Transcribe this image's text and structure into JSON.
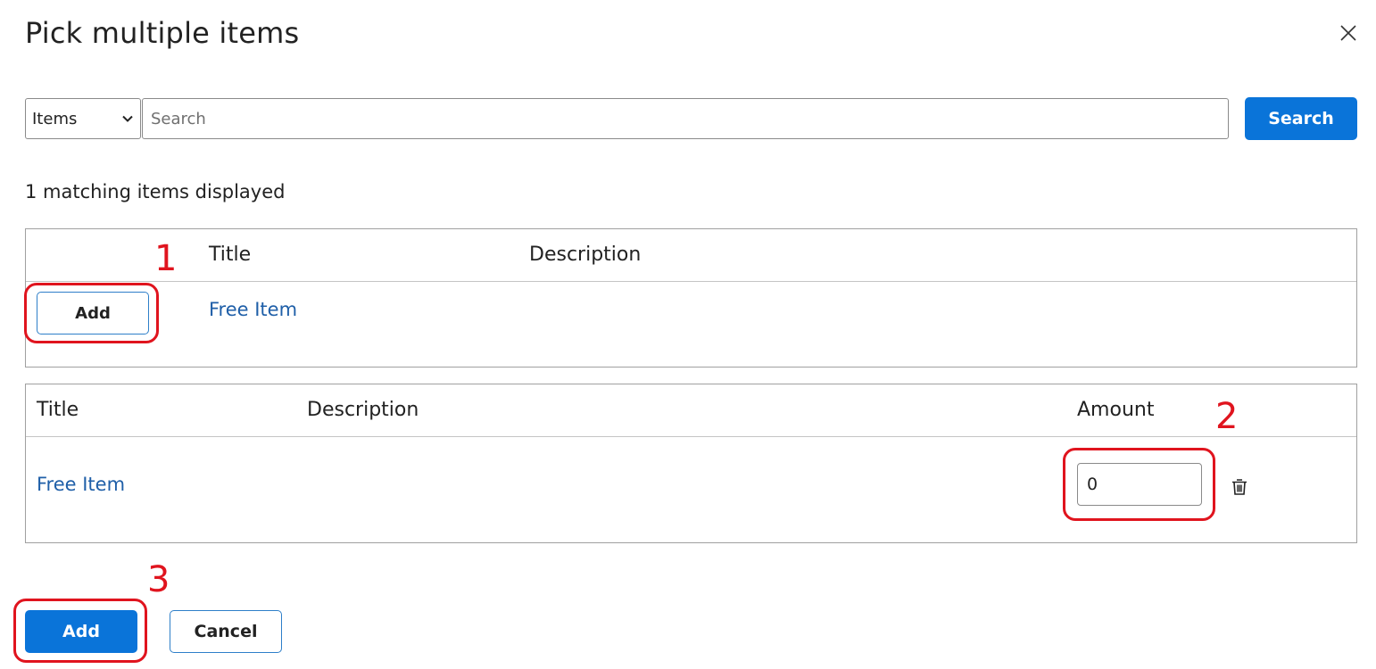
{
  "dialog": {
    "title": "Pick multiple items"
  },
  "search": {
    "type_selected": "Items",
    "placeholder": "Search",
    "value": "",
    "button_label": "Search"
  },
  "results": {
    "count_text": "1 matching items displayed",
    "columns": {
      "title": "Title",
      "description": "Description"
    },
    "rows": [
      {
        "add_label": "Add",
        "title": "Free Item",
        "description": ""
      }
    ]
  },
  "selected": {
    "columns": {
      "title": "Title",
      "description": "Description",
      "amount": "Amount"
    },
    "rows": [
      {
        "title": "Free Item",
        "description": "",
        "amount": "0"
      }
    ]
  },
  "footer": {
    "add_label": "Add",
    "cancel_label": "Cancel"
  },
  "annotations": [
    "1",
    "2",
    "3"
  ],
  "colors": {
    "primary": "#0a74d9",
    "link": "#1f5fa8",
    "annotation": "#e0141e"
  },
  "icons": [
    "close-icon",
    "chevron-down-icon",
    "trash-icon"
  ]
}
